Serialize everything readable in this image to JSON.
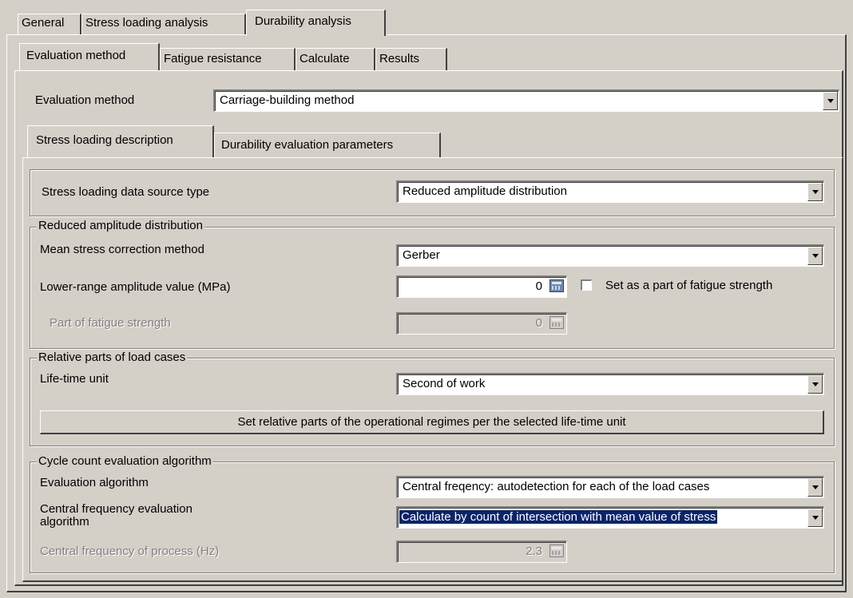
{
  "tabs_top": [
    "General",
    "Stress loading analysis",
    "Durability analysis"
  ],
  "tabs_sub": [
    "Evaluation method",
    "Fatigue resistance",
    "Calculate",
    "Results"
  ],
  "evaluation_method": {
    "label": "Evaluation method",
    "value": "Carriage-building method"
  },
  "tabs_inner": [
    "Stress loading description",
    "Durability evaluation parameters"
  ],
  "source_type": {
    "label": "Stress loading data source type",
    "value": "Reduced amplitude distribution"
  },
  "reduced": {
    "legend": "Reduced amplitude distribution",
    "mean_label": "Mean stress correction method",
    "mean_value": "Gerber",
    "lower_label": "Lower-range amplitude value (MPa)",
    "lower_value": "0",
    "checkbox_label": "Set as a part of fatigue strength",
    "part_label": "Part of fatigue strength",
    "part_value": "0"
  },
  "relative": {
    "legend": "Relative parts of load cases",
    "life_label": "Life-time unit",
    "life_value": "Second of work",
    "button_label": "Set relative parts of the operational regimes per the selected life-time unit"
  },
  "cycle": {
    "legend": "Cycle count evaluation algorithm",
    "algo_label": "Evaluation algorithm",
    "algo_value": "Central freqency: autodetection for each of the load cases",
    "cf_label_1": "Central frequency evaluation",
    "cf_label_2": "algorithm",
    "cf_value": "Calculate by count of intersection with mean value of stress",
    "freq_label": "Central frequency of process (Hz)",
    "freq_value": "2.3"
  },
  "icons": {
    "calculator": "calculator-icon",
    "dropdown": "chevron-down-icon"
  }
}
